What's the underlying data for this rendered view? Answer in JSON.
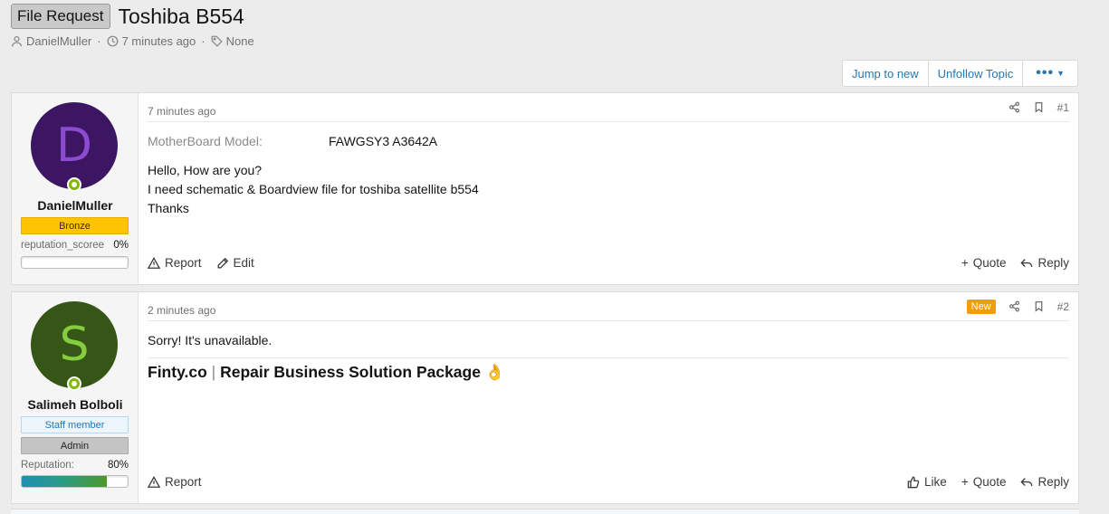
{
  "thread": {
    "prefix": "File Request",
    "title": "Toshiba B554",
    "author": "DanielMuller",
    "time": "7 minutes ago",
    "tags": "None"
  },
  "actions": {
    "jump": "Jump to new",
    "unfollow": "Unfollow Topic",
    "more": "•••"
  },
  "posts": [
    {
      "avatar_letter": "D",
      "username": "DanielMuller",
      "banner": "Bronze",
      "rep_label": "reputation_scoree",
      "rep_pct": "0%",
      "rep_fraction": 0,
      "date": "7 minutes ago",
      "number": "#1",
      "field_label": "MotherBoard Model:",
      "field_value": "FAWGSY3 A3642A",
      "lines": [
        "Hello, How are you?",
        "I need schematic & Boardview file for toshiba satellite b554",
        "Thanks"
      ],
      "report": "Report",
      "edit": "Edit",
      "quote": "Quote",
      "reply": "Reply"
    },
    {
      "avatar_letter": "S",
      "username": "Salimeh Bolboli",
      "banner_staff": "Staff member",
      "banner_admin": "Admin",
      "rep_label": "Reputation:",
      "rep_pct": "80%",
      "rep_fraction": 0.8,
      "date": "2 minutes ago",
      "new_badge": "New",
      "number": "#2",
      "lines": [
        "Sorry! It's unavailable."
      ],
      "sig_name": "Finty.co",
      "sig_sep": "|",
      "sig_text": "Repair Business Solution Package",
      "sig_emoji": "👌",
      "report": "Report",
      "like": "Like",
      "quote": "Quote",
      "reply": "Reply"
    }
  ]
}
